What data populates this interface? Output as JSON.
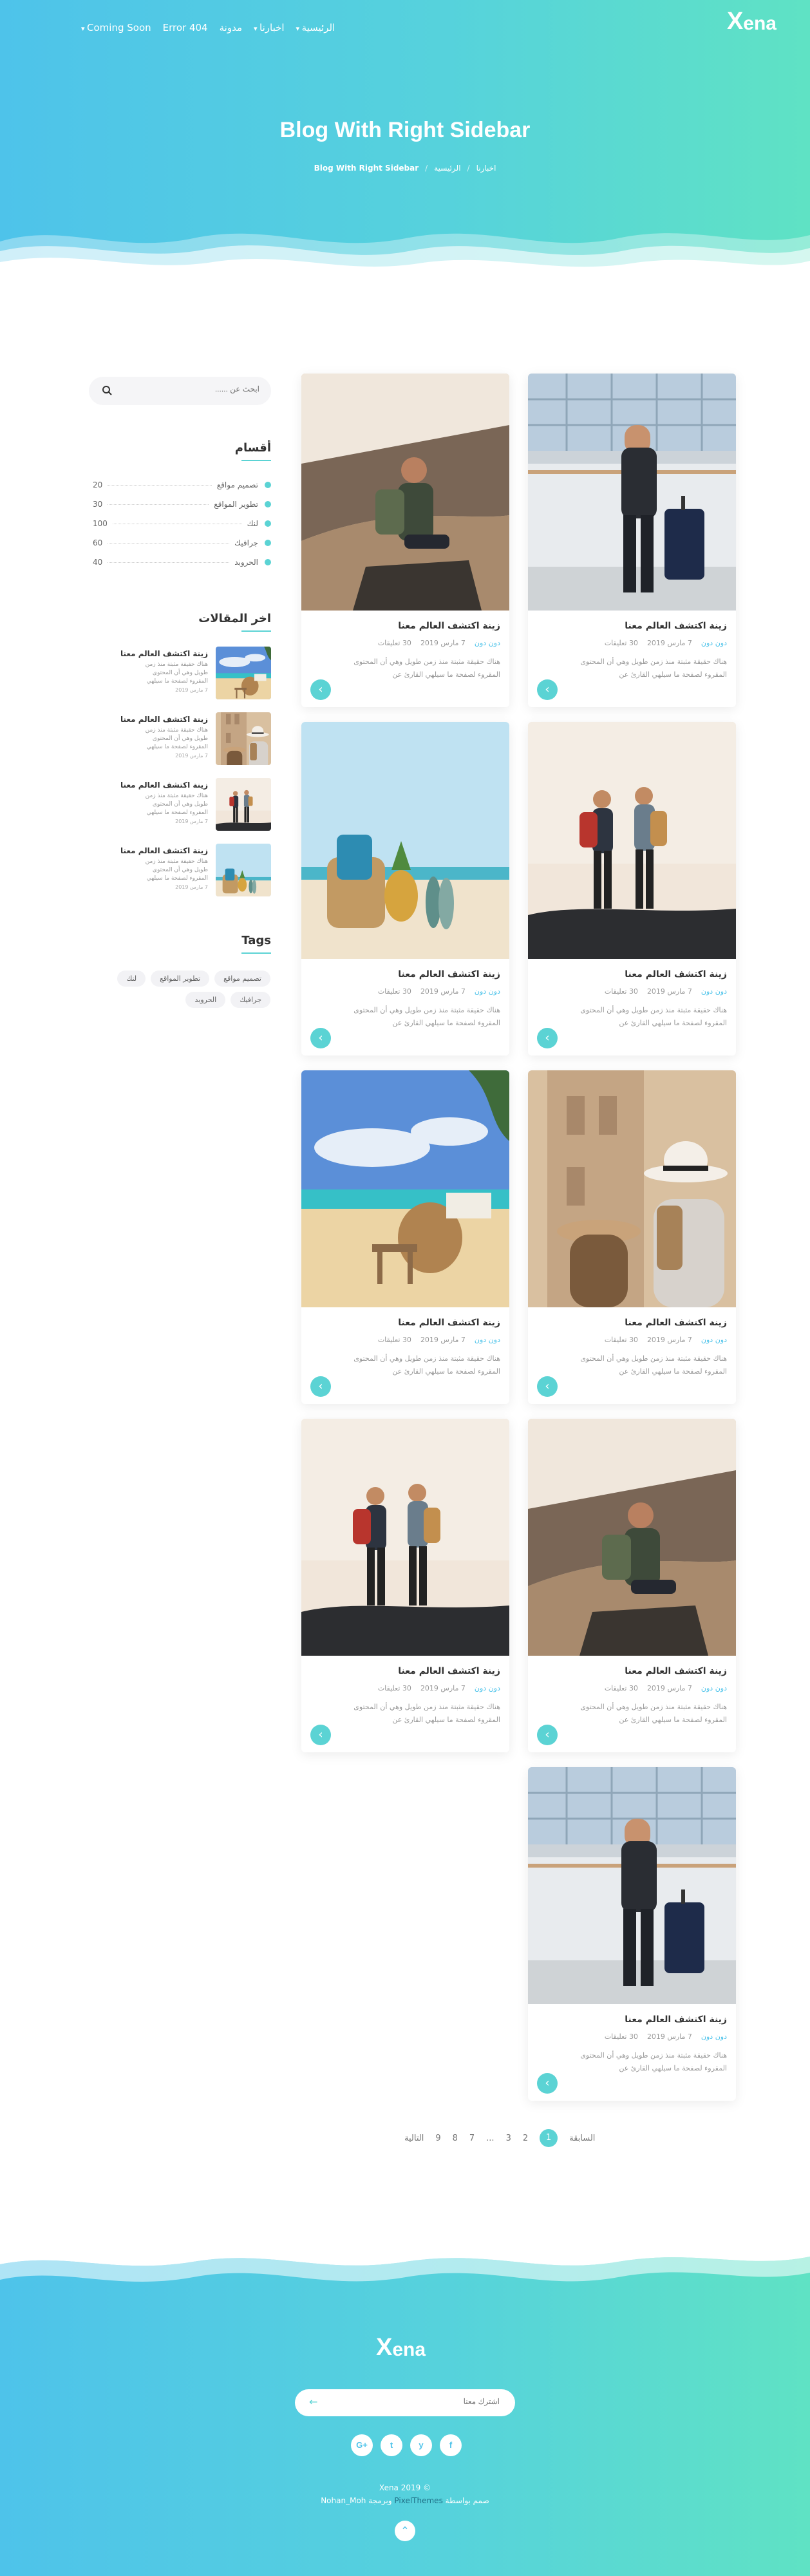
{
  "brand": {
    "name": "Xena",
    "mark": "X",
    "rest": "ena"
  },
  "nav": [
    {
      "label": "الرئيسية",
      "dropdown": true
    },
    {
      "label": "اخبارنا",
      "dropdown": true
    },
    {
      "label": "مدونة",
      "dropdown": false
    },
    {
      "label": "Error 404",
      "dropdown": false
    },
    {
      "label": "Coming Soon",
      "dropdown": true
    }
  ],
  "hero": {
    "title": "Blog With Right Sidebar",
    "breadcrumb": [
      "الرئيسية",
      "اخبارنا",
      "Blog With Right Sidebar"
    ]
  },
  "post": {
    "title": "زينة اكتشف العالم معنا",
    "author": "دون دون",
    "date": "7 مارس 2019",
    "comments": "30 تعليقات",
    "excerpt": "هناك حقيقة مثبتة منذ زمن طويل وهي أن المحتوى المقروء لصفحة ما سيلهي القارئ عن"
  },
  "posts_images": [
    "luggage",
    "hiker",
    "couple",
    "beach-basket",
    "pointing",
    "beach-chairs",
    "couple",
    "hiker",
    "luggage"
  ],
  "sidebar": {
    "search_placeholder": "ابحث عن ......",
    "categories_title": "أقسام",
    "categories": [
      {
        "name": "تصميم مواقع",
        "count": "20"
      },
      {
        "name": "تطوير المواقع",
        "count": "30"
      },
      {
        "name": "لنك",
        "count": "100"
      },
      {
        "name": "جرافيك",
        "count": "60"
      },
      {
        "name": "الحروبد",
        "count": "40"
      }
    ],
    "recent_title": "اخر المقالات",
    "recent": [
      {
        "title": "زينة اكتشف العالم معنا",
        "text": "هناك حقيقة مثبتة منذ زمن طويل وهي أن المحتوى المقروء لصفحة ما سيلهي",
        "date": "7 مارس 2019"
      },
      {
        "title": "زينة اكتشف العالم معنا",
        "text": "هناك حقيقة مثبتة منذ زمن طويل وهي أن المحتوى المقروء لصفحة ما سيلهي",
        "date": "7 مارس 2019"
      },
      {
        "title": "زينة اكتشف العالم معنا",
        "text": "هناك حقيقة مثبتة منذ زمن طويل وهي أن المحتوى المقروء لصفحة ما سيلهي",
        "date": "7 مارس 2019"
      },
      {
        "title": "زينة اكتشف العالم معنا",
        "text": "هناك حقيقة مثبتة منذ زمن طويل وهي أن المحتوى المقروء لصفحة ما سيلهي",
        "date": "7 مارس 2019"
      }
    ],
    "tags_title": "Tags",
    "tags": [
      "تصميم مواقع",
      "تطوير المواقع",
      "لنك",
      "جرافيك",
      "الحروبد"
    ]
  },
  "pagination": {
    "prev": "السابقة",
    "current": "1",
    "pages": [
      "2",
      "3",
      "...",
      "7",
      "8",
      "9"
    ],
    "next": "التالية"
  },
  "footer": {
    "subscribe_placeholder": "اشترك معنا",
    "socials": [
      "f",
      "y",
      "t",
      "G+"
    ],
    "copyright": "Xena 2019 ©",
    "credit_prefix": "صمم بواسطة",
    "credit_author": "PixelThemes",
    "credit_mid": "وبرمجة",
    "credit_dev": "Nohan_Moh"
  },
  "colors": {
    "accent": "#5bd3d4",
    "gradient_start": "#4ec3ea",
    "gradient_end": "#5fe2c4"
  }
}
